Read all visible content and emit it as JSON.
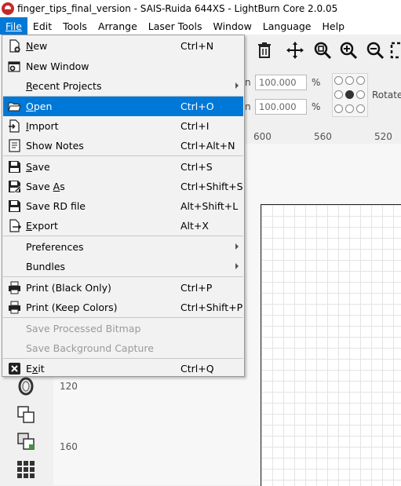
{
  "window": {
    "title": "finger_tips_final_version - SAIS-Ruida 644XS - LightBurn Core 2.0.05",
    "brand_color": "#c62828"
  },
  "menubar": {
    "items": [
      "File",
      "Edit",
      "Tools",
      "Arrange",
      "Laser Tools",
      "Window",
      "Language",
      "Help"
    ],
    "active": "File"
  },
  "toolbar": {
    "width_value": "100.000",
    "height_value": "100.000",
    "percent": "%",
    "rotate_label": "Rotate",
    "partial_label": "n"
  },
  "rulers": {
    "top": [
      "600",
      "560",
      "520"
    ],
    "left": [
      "120",
      "160"
    ]
  },
  "file_menu": {
    "highlight_color": "#0078d7",
    "items": [
      {
        "label": "New",
        "shortcut": "Ctrl+N",
        "icon": "new-file-icon"
      },
      {
        "label": "New Window",
        "shortcut": "",
        "icon": "new-window-icon"
      },
      {
        "label": "Recent Projects",
        "shortcut": "",
        "icon": "",
        "submenu": true
      },
      {
        "label": "Open",
        "shortcut": "Ctrl+O",
        "icon": "folder-open-icon",
        "highlighted": true
      },
      {
        "label": "Import",
        "shortcut": "Ctrl+I",
        "icon": "import-icon"
      },
      {
        "label": "Show Notes",
        "shortcut": "Ctrl+Alt+N",
        "icon": "notes-icon"
      },
      {
        "label": "Save",
        "shortcut": "Ctrl+S",
        "icon": "save-icon"
      },
      {
        "label": "Save As",
        "shortcut": "Ctrl+Shift+S",
        "icon": "save-as-icon"
      },
      {
        "label": "Save RD file",
        "shortcut": "Alt+Shift+L",
        "icon": "save-rd-icon"
      },
      {
        "label": "Export",
        "shortcut": "Alt+X",
        "icon": "export-icon"
      },
      {
        "label": "Preferences",
        "shortcut": "",
        "icon": "",
        "submenu": true
      },
      {
        "label": "Bundles",
        "shortcut": "",
        "icon": "",
        "submenu": true
      },
      {
        "label": "Print (Black Only)",
        "shortcut": "Ctrl+P",
        "icon": "printer-icon"
      },
      {
        "label": "Print (Keep Colors)",
        "shortcut": "Ctrl+Shift+P",
        "icon": "printer-icon"
      },
      {
        "label": "Save Processed Bitmap",
        "shortcut": "",
        "icon": "",
        "disabled": true
      },
      {
        "label": "Save Background Capture",
        "shortcut": "",
        "icon": "",
        "disabled": true
      },
      {
        "label": "Exit",
        "shortcut": "Ctrl+Q",
        "icon": "exit-icon"
      }
    ]
  }
}
